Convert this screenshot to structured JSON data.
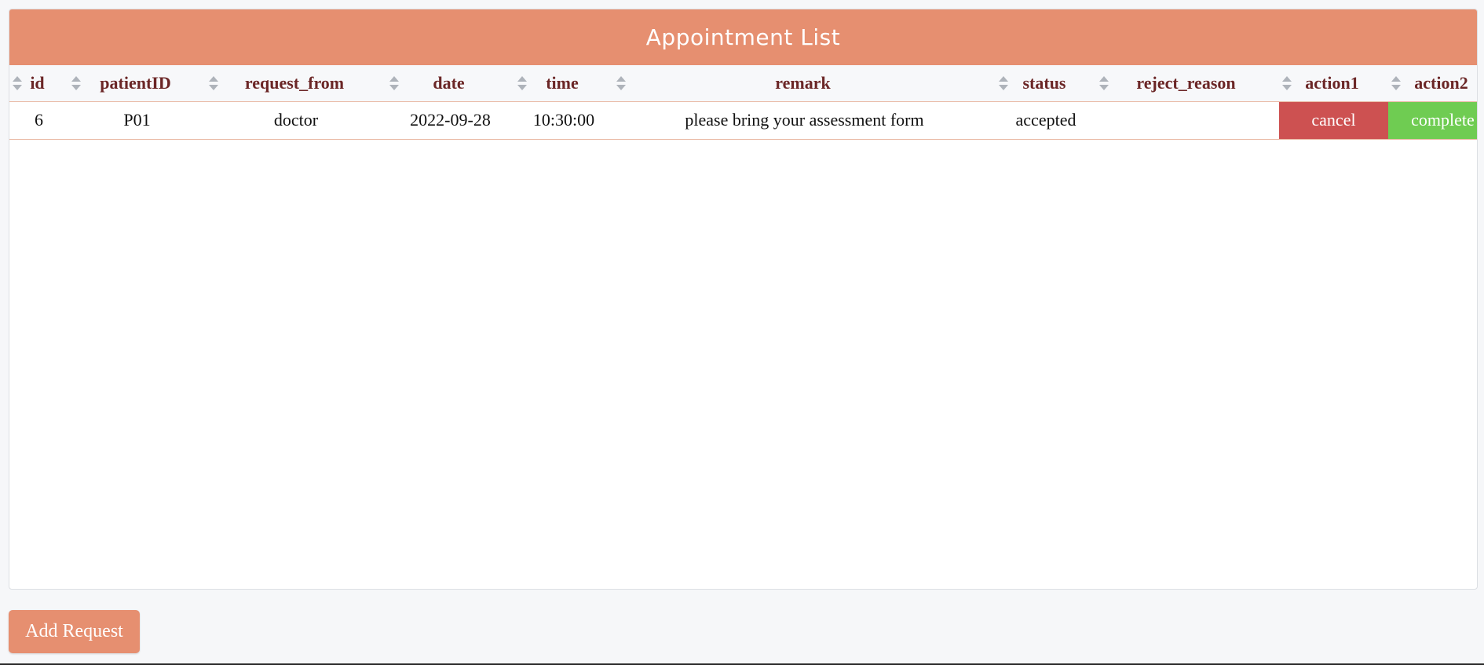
{
  "title": "Appointment List",
  "table": {
    "columns": [
      "id",
      "patientID",
      "request_from",
      "date",
      "time",
      "remark",
      "status",
      "reject_reason",
      "action1",
      "action2"
    ],
    "rows": [
      {
        "id": "6",
        "patientID": "P01",
        "request_from": "doctor",
        "date": "2022-09-28",
        "time": "10:30:00",
        "remark": "please bring your assessment form",
        "status": "accepted",
        "reject_reason": "",
        "action1": "cancel",
        "action2": "complete"
      }
    ]
  },
  "add_button_label": "Add Request",
  "colors": {
    "header_bar": "#e68f70",
    "cancel": "#cd5151",
    "complete": "#6fcc52",
    "header_text": "#6b2626"
  },
  "icons": {
    "sort": "sort-icon"
  }
}
